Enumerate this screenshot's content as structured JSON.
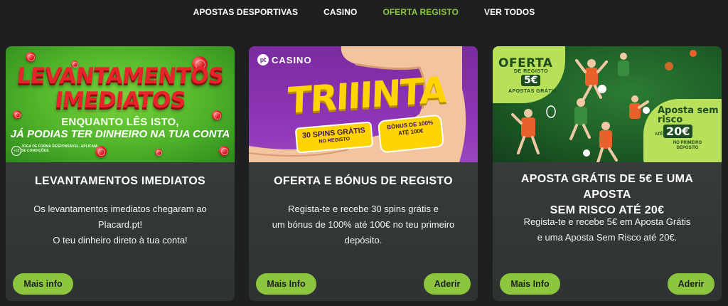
{
  "nav": {
    "items": [
      {
        "label": "APOSTAS DESPORTIVAS",
        "active": false
      },
      {
        "label": "CASINO",
        "active": false
      },
      {
        "label": "OFERTA REGISTO",
        "active": true
      },
      {
        "label": "VER TODOS",
        "active": false
      }
    ]
  },
  "colors": {
    "accent": "#8cc63f",
    "background": "#1d1f21",
    "card": "#3a3d3e",
    "banner_red": "#e8232a",
    "banner_yellow": "#ffd400",
    "banner_purple": "#8d34b5"
  },
  "cards": [
    {
      "banner": {
        "headline_1": "LEVANTAMENTOS",
        "headline_2": "IMEDIATOS",
        "sub_1": "ENQUANTO LÊS ISTO,",
        "sub_2": "JÁ PODIAS TER DINHEIRO NA TUA CONTA",
        "age": "+18",
        "legal": "JOGA DE FORMA RESPONSÁVEL. APLICAM-SE CONDIÇÕES."
      },
      "title": "LEVANTAMENTOS IMEDIATOS",
      "desc_lines": [
        "Os levantamentos imediatos chegaram ao",
        "Placard.pt!",
        "O teu dinheiro direto à tua conta!"
      ],
      "info_label": "Mais info"
    },
    {
      "banner": {
        "logo_mark": "pt",
        "logo_text": "CASINO",
        "headline": "TRIIINTA",
        "pill1_a": "30 SPINS GRÁTIS",
        "pill1_b": "NO REGISTO",
        "pill2_a": "BÓNUS DE 100%",
        "pill2_b": "ATÉ 100€"
      },
      "title": "OFERTA E BÓNUS DE REGISTO",
      "desc_lines": [
        "Regista-te e recebe 30 spins grátis e",
        "um bónus de 100% até 100€ no teu primeiro",
        "depósito."
      ],
      "info_label": "Mais Info",
      "join_label": "Aderir"
    },
    {
      "banner": {
        "offer_1": "OFERTA",
        "offer_2": "DE REGISTO",
        "offer_3": "5€",
        "offer_4": "APOSTAS GRÁTIS",
        "risk_1": "Aposta sem risco",
        "risk_2": "ATÉ",
        "risk_3": "20€",
        "risk_4": "NO PRIMEIRO DEPÓSITO"
      },
      "title_lines": [
        "APOSTA GRÁTIS DE 5€ E UMA APOSTA",
        "SEM RISCO ATÉ 20€"
      ],
      "desc_lines": [
        "Regista-te e recebe 5€ em Aposta Grátis",
        "e uma Aposta Sem Risco até 20€."
      ],
      "info_label": "Mais Info",
      "join_label": "Aderir"
    }
  ]
}
